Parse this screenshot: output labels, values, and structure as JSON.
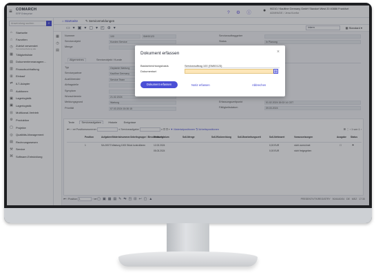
{
  "app": {
    "brand": "COMARCH",
    "brand_sub": "ERP Enterprise",
    "user_line1": "90210 / Kaufline Germany GmbH Standort West 20 40886 Frankfurt",
    "user_line2": "ADMIN/DE / Jena Konfor"
  },
  "sidebar": {
    "search_placeholder": "Anwendung suchen",
    "items": [
      {
        "icon": "home-icon",
        "glyph": "⌂",
        "label": "Startseite"
      },
      {
        "icon": "star-icon",
        "glyph": "☆",
        "label": "Favoriten"
      },
      {
        "icon": "clock-icon",
        "glyph": "◷",
        "label": "Zuletzt verwendet",
        "sub": "Servicebearbeitung alle"
      },
      {
        "icon": "calendar-icon",
        "glyph": "▦",
        "label": "Tätigkeitsliste"
      },
      {
        "icon": "document-icon",
        "glyph": "▤",
        "label": "Dokumentenmanagem..."
      },
      {
        "icon": "finance-icon",
        "glyph": "▥",
        "label": "Finanzbuchhaltung"
      },
      {
        "icon": "cart-icon",
        "glyph": "⊞",
        "label": "Einkauf"
      },
      {
        "icon": "adapter-icon",
        "glyph": "⇄",
        "label": "ILT-Adapter"
      },
      {
        "icon": "auction-icon",
        "glyph": "⚖",
        "label": "Auktionen"
      },
      {
        "icon": "warehouse-icon",
        "glyph": "▣",
        "label": "Lagerlogistik"
      },
      {
        "icon": "warehouse2-icon",
        "glyph": "▣",
        "label": "Lagerlogistik"
      },
      {
        "icon": "channel-icon",
        "glyph": "⊟",
        "label": "Multikanal-Vertrieb"
      },
      {
        "icon": "production-icon",
        "glyph": "⚙",
        "label": "Produktion"
      },
      {
        "icon": "project-icon",
        "glyph": "▢",
        "label": "Projekte"
      },
      {
        "icon": "quality-icon",
        "glyph": "◎",
        "label": "Qualitäts-Management"
      },
      {
        "icon": "accounting-icon",
        "glyph": "▤",
        "label": "Rechnungswesen"
      },
      {
        "icon": "service-icon",
        "glyph": "⚒",
        "label": "Service"
      },
      {
        "icon": "code-icon",
        "glyph": "⌘",
        "label": "Software-Entwicklung"
      }
    ]
  },
  "main": {
    "tabs": [
      "Startseite",
      "Servicemeldungen"
    ],
    "toolbar_select": "intern",
    "toolbar_standard": "Standard",
    "header_fields": [
      {
        "label": "Nummer",
        "value": "SM/00123"
      },
      {
        "label": "Serviceobjekt",
        "value": "Kunden Service"
      },
      {
        "label": "Menge",
        "value": ""
      },
      {
        "label": "Serviceauftraggeber",
        "value": ""
      },
      {
        "label": "Status",
        "value": "In Planung"
      }
    ],
    "subtabs": [
      "Allgemeines",
      "Serviceobjekt / Kunde",
      "Serviceauftrag"
    ],
    "detail_fields": [
      {
        "label": "Typ",
        "value": "Geplante Wartung"
      },
      {
        "label": "Servicepartner",
        "value": "Kaufline Germany"
      },
      {
        "label": "Ausführender",
        "value": "Service Team"
      },
      {
        "label": "Abfragstelle",
        "value": ""
      },
      {
        "label": "Symptom",
        "value": ""
      },
      {
        "label": "Wunschtermin",
        "value": "21.02.2024"
      },
      {
        "label": "Meldungsgrund",
        "value": "Wartung"
      },
      {
        "label": "Priorität",
        "value": "07.03.2024 15:30:15"
      }
    ],
    "detail_right": [
      {
        "label": "Erfassungszeitpunkt",
        "value": "01.02.2024 15:02:14 CET"
      },
      {
        "label": "Fälligkeitsdatum",
        "value": "09.03.2024"
      }
    ]
  },
  "lower": {
    "tabs": [
      "Texte",
      "Serviceaufgaben",
      "Historie",
      "Ereignisse"
    ],
    "bar_label": "Positionsnummer",
    "bar_label2": "Serviceaufgabe",
    "bar_link1": "Materialpositionen",
    "bar_link2": "Arbeitspositionen",
    "pager": "1 von 1",
    "headers": [
      "Position",
      "Aufgaben/Materialnummer/Arbeitsgruppe / Beschreibung",
      "Wunschdatum",
      "Soll-Menge",
      "Soll-Rückmeldung",
      "Soll-Bearbeitungszeit",
      "Soll-Nettowert",
      "Voraussetzungen",
      "Ausgabe",
      "Status"
    ],
    "row": {
      "pos": "1",
      "task": "SA-00073 Wartung 1000 Stück kontrollieren",
      "date1": "12.02.2024",
      "date2": "05.03.2024",
      "net1": "0,00 EUR",
      "net2": "0,00 EUR",
      "req1": "nicht vorrechnet",
      "req2": "nicht freigegeben"
    }
  },
  "footer": {
    "position_label": "Position",
    "position_value": "1",
    "status_items": [
      "PRESENT/VTK/REGISTRY",
      "90/4440/04",
      "DE",
      "MEZ",
      "17:30"
    ]
  },
  "modal": {
    "title": "Dokument erfassen",
    "close": "×",
    "field1_label": "Basiseinrichtungsbasis",
    "field1_value": "Serviceauftrag 100 (SM00123)",
    "field2_label": "Dokumentart",
    "field2_value": "",
    "btn_primary": "Dokument erfassen",
    "btn_notice": "Notiz erfassen",
    "btn_cancel": "Abbrechen"
  }
}
